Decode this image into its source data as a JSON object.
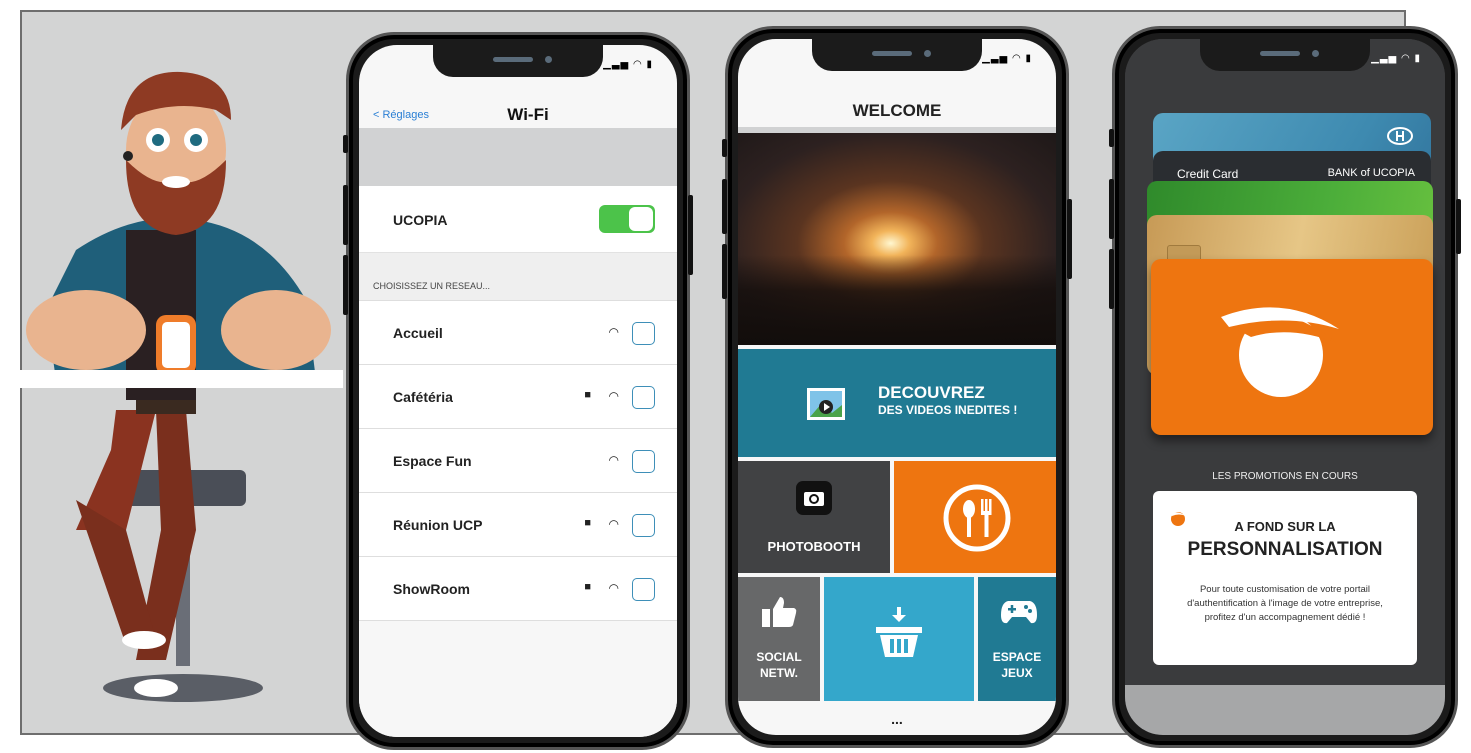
{
  "phone_wifi": {
    "back_label": "< Réglages",
    "title": "Wi-Fi",
    "primary_network": "UCOPIA",
    "toggle_on": true,
    "section_header": "CHOISISSEZ UN RESEAU...",
    "networks": [
      {
        "name": "Accueil",
        "locked": false
      },
      {
        "name": "Cafétéria",
        "locked": true
      },
      {
        "name": "Espace Fun",
        "locked": false
      },
      {
        "name": "Réunion UCP",
        "locked": true
      },
      {
        "name": "ShowRoom",
        "locked": true
      }
    ]
  },
  "phone_portal": {
    "title": "WELCOME",
    "videos_line1": "DECOUVREZ",
    "videos_line2": "DES VIDEOS INEDITES !",
    "photobooth": "PHOTOBOOTH",
    "social_line1": "SOCIAL",
    "social_line2": "NETW.",
    "jeux_line1": "ESPACE",
    "jeux_line2": "JEUX",
    "more": "..."
  },
  "phone_wallet": {
    "card_left_label": "Credit Card",
    "card_right_label": "BANK of UCOPIA",
    "promotions_label": "LES PROMOTIONS EN COURS",
    "promo_heading1": "A FOND SUR LA",
    "promo_heading2": "PERSONNALISATION",
    "promo_body": "Pour toute customisation de votre portail d'authentification à l'image de votre entreprise, profitez d'un accompagnement dédié !"
  },
  "colors": {
    "accent_teal": "#207a93",
    "accent_blue": "#34a7cb",
    "accent_orange": "#ee7510",
    "toggle_green": "#4cc34a",
    "background_panel": "#d3d4d4"
  }
}
